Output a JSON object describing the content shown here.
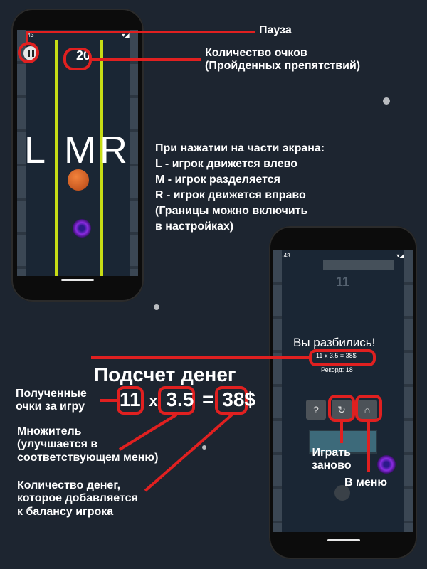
{
  "left_phone": {
    "status_time": "3:43",
    "score": "20",
    "zones": [
      "L",
      "M",
      "R"
    ]
  },
  "right_phone": {
    "status_time": "3:43",
    "score": "11",
    "crash_title": "Вы разбились!",
    "money_line": "11 x 3.5 = 38$",
    "record_line": "Рекорд: 18",
    "help_label": "?"
  },
  "annotations": {
    "pause": "Пауза",
    "score_count": "Количество очков\n(Пройденных препятствий)",
    "tap_zones": "При нажатии на части экрана:\nL - игрок движется влево\nM - игрок разделяется\nR - игрок движется вправо\n(Границы можно включить\nв настройках)",
    "money_title": "Подсчет денег",
    "formula_a": "11",
    "formula_x": "x",
    "formula_b": "3.5",
    "formula_eq": "=",
    "formula_c": "38$",
    "earned_points": "Полученные\nочки за игру",
    "multiplier": "Множитель\n(улучшается в\nсоответствующем меню)",
    "money_amount": "Количество денег,\nкоторое добавляется\nк балансу игрока",
    "replay": "Играть\nзаново",
    "to_menu": "В меню"
  },
  "colors": {
    "accent_red": "#e02020",
    "lane_yellow": "#c7dd15",
    "background": "#1d2530"
  }
}
